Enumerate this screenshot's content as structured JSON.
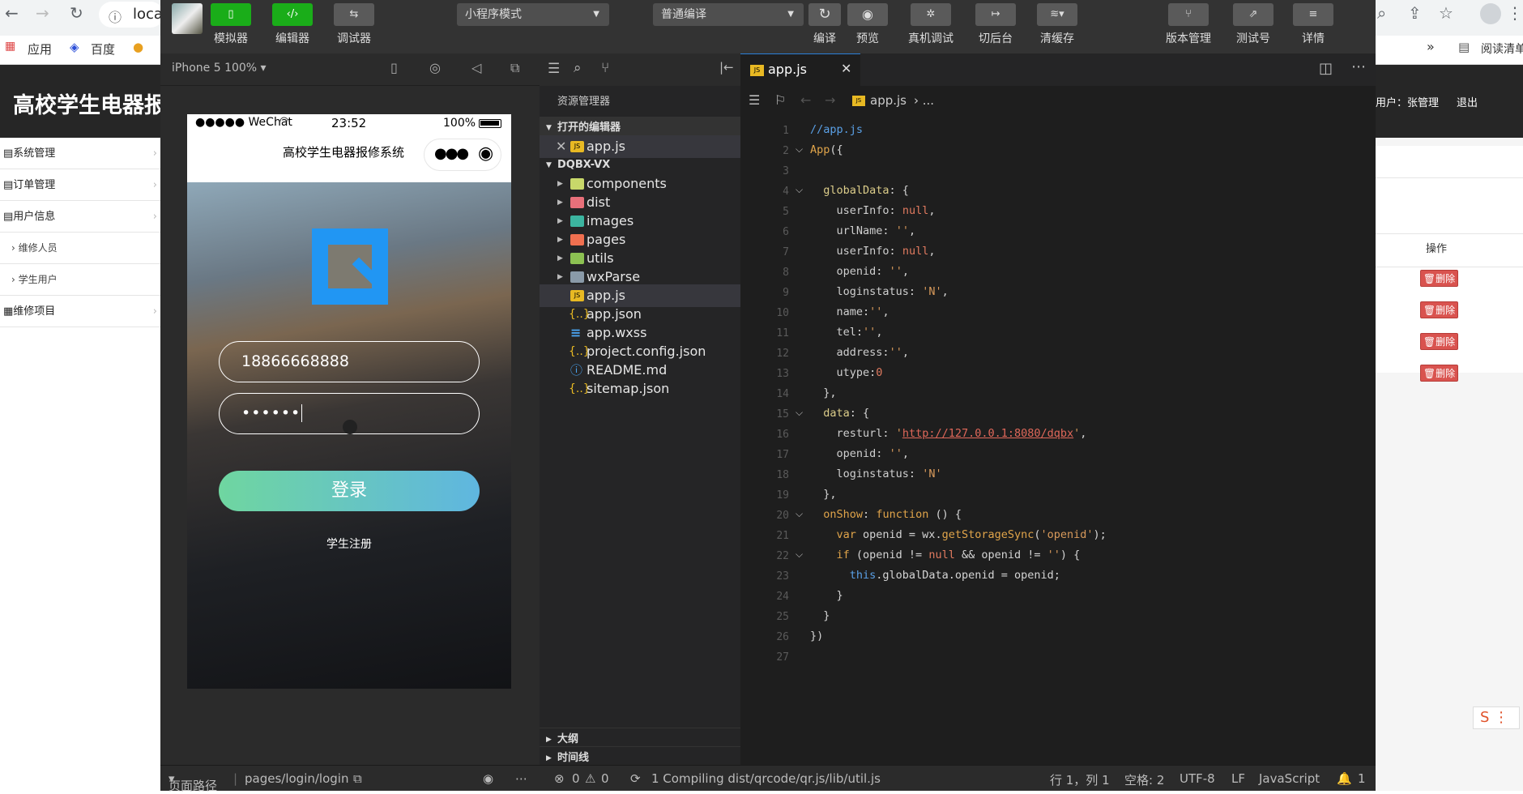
{
  "browser": {
    "url_fragment": "loca",
    "bookmarks": [
      "应用",
      "百度"
    ],
    "more": "»",
    "reading_list": "阅读清单"
  },
  "admin": {
    "title": "高校学生电器报",
    "user_label": "用户：张管理",
    "logout": "退出",
    "sidebar": [
      {
        "label": "系统管理"
      },
      {
        "label": "订单管理"
      },
      {
        "label": "用户信息"
      },
      {
        "label": "维修人员"
      },
      {
        "label": "学生用户"
      },
      {
        "label": "维修项目"
      }
    ],
    "table_header": "操作",
    "delete_label": "删除"
  },
  "toolbar": {
    "simulator": "模拟器",
    "editor": "编辑器",
    "debugger": "调试器",
    "mode_select": "小程序模式",
    "compile_select": "普通编译",
    "compile": "编译",
    "preview": "预览",
    "real_debug": "真机调试",
    "background": "切后台",
    "clear_cache": "清缓存",
    "version": "版本管理",
    "test_account": "测试号",
    "details": "详情"
  },
  "simulator": {
    "device": "iPhone 5 100%",
    "status_carrier": "●●●●● WeChat",
    "status_time": "23:52",
    "status_battery": "100%",
    "nav_title": "高校学生电器报修系统",
    "phone_value": "18866668888",
    "password_value": "••••••",
    "login_button": "登录",
    "register_link": "学生注册"
  },
  "explorer": {
    "title": "资源管理器",
    "open_editors": "打开的编辑器",
    "open_file": "app.js",
    "project": "DQBX-VX",
    "folders": [
      "components",
      "dist",
      "images",
      "pages",
      "utils",
      "wxParse"
    ],
    "files": [
      "app.js",
      "app.json",
      "app.wxss",
      "project.config.json",
      "README.md",
      "sitemap.json"
    ],
    "outline": "大纲",
    "timeline": "时间线"
  },
  "editor": {
    "tab": "app.js",
    "breadcrumb_file": "app.js",
    "breadcrumb_more": "› ..."
  },
  "statusbar": {
    "page_path_label": "页面路径",
    "page_path": "pages/login/login",
    "errors": "0",
    "warnings": "0",
    "compiling": "1 Compiling dist/qrcode/qr.js/lib/util.js",
    "position": "行 1，列 1",
    "spaces": "空格: 2",
    "encoding": "UTF-8",
    "eol": "LF",
    "language": "JavaScript",
    "notifications": "1"
  }
}
